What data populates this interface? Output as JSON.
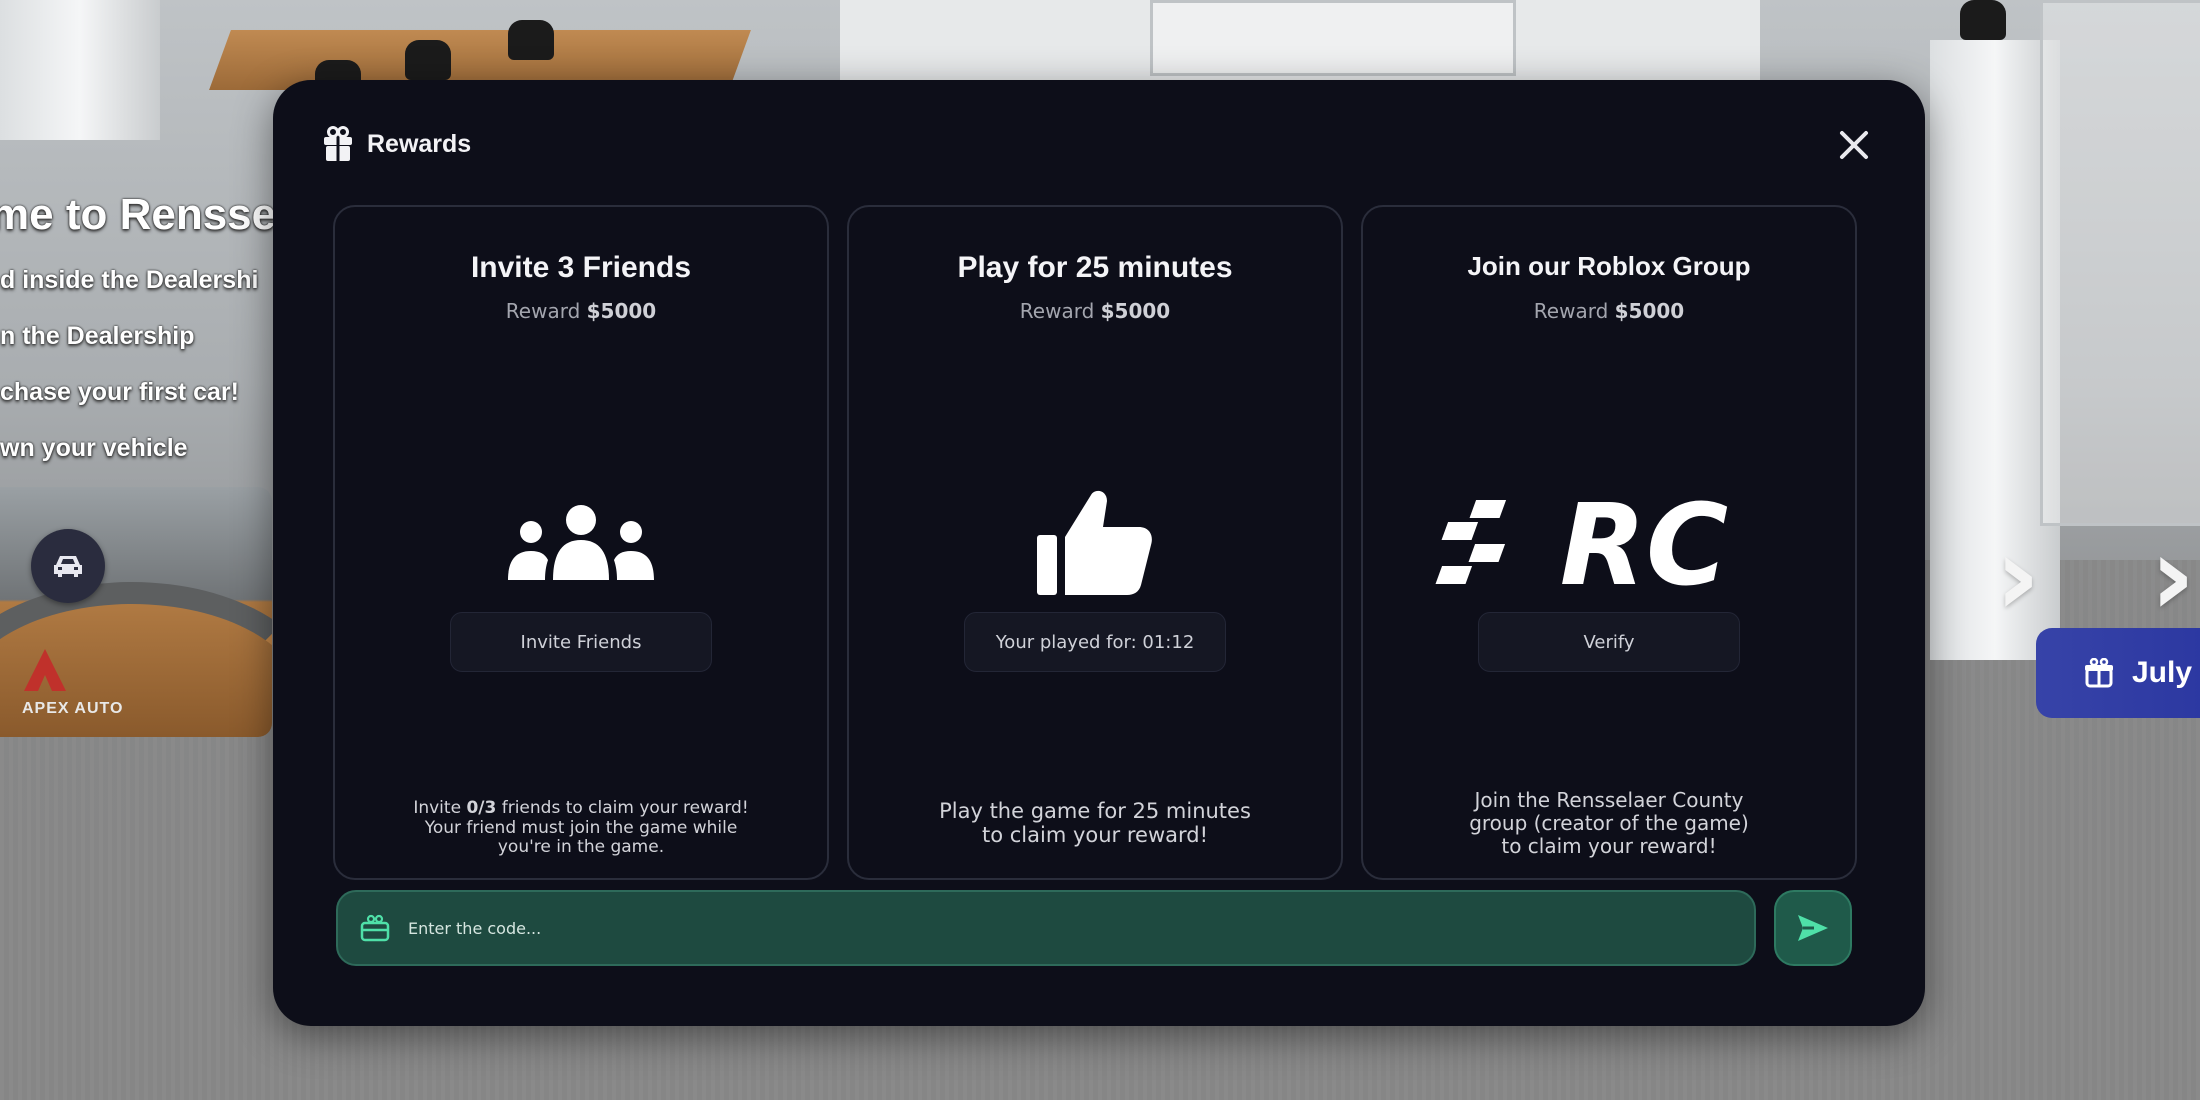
{
  "hud": {
    "quest_title": "me to Rensse",
    "quest_lines": [
      "d inside the Dealershi",
      "n the Dealership",
      "chase your first car!",
      "wn your vehicle"
    ],
    "preview_logo": "APEX AUTO",
    "event_badge": "July"
  },
  "modal": {
    "title": "Rewards",
    "cards": [
      {
        "title": "Invite 3 Friends",
        "reward_label": "Reward",
        "reward_value": "$5000",
        "icon": "group-icon",
        "button": "Invite Friends",
        "desc_parts": [
          "Invite ",
          "0/3",
          " friends to claim your reward!"
        ],
        "desc_line2": "Your friend must join the game while",
        "desc_line3": "you're in the game."
      },
      {
        "title": "Play for 25 minutes",
        "reward_label": "Reward",
        "reward_value": "$5000",
        "icon": "thumbs-up-icon",
        "button": "Your played for: 01:12",
        "desc_line1": "Play the game for 25 minutes",
        "desc_line2": "to claim your reward!"
      },
      {
        "title": "Join our Roblox Group",
        "reward_label": "Reward",
        "reward_value": "$5000",
        "icon": "rc-logo",
        "logo_text": "RC",
        "button": "Verify",
        "desc_line1": "Join the Rensselaer County",
        "desc_line2": "group (creator of the game)",
        "desc_line3": "to claim your reward!"
      }
    ],
    "code_input": {
      "placeholder": "Enter the code...",
      "value": ""
    }
  },
  "colors": {
    "modal_bg": "#0d0e19",
    "card_border": "#2a2d3b",
    "accent_green": "#1e4a40",
    "accent_green_icon": "#4fe0a8"
  }
}
